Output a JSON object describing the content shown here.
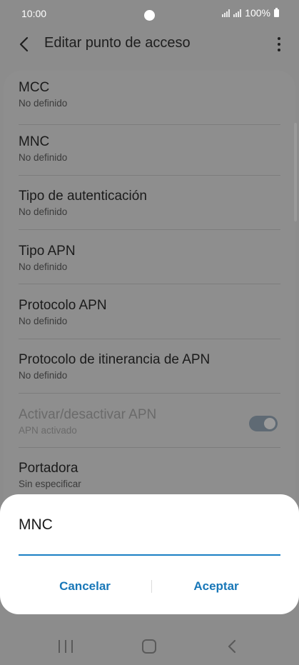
{
  "status_bar": {
    "time": "10:00",
    "battery": "100%"
  },
  "app_bar": {
    "title": "Editar punto de acceso"
  },
  "settings": [
    {
      "title": "MCC",
      "subtitle": "No definido"
    },
    {
      "title": "MNC",
      "subtitle": "No definido"
    },
    {
      "title": "Tipo de autenticación",
      "subtitle": "No definido"
    },
    {
      "title": "Tipo APN",
      "subtitle": "No definido"
    },
    {
      "title": "Protocolo APN",
      "subtitle": "No definido"
    },
    {
      "title": "Protocolo de itinerancia de APN",
      "subtitle": "No definido"
    },
    {
      "title": "Activar/desactivar APN",
      "subtitle": "APN activado"
    },
    {
      "title": "Portadora",
      "subtitle": "Sin especificar"
    }
  ],
  "toggle": {
    "enabled": true,
    "disabled_state": true
  },
  "dialog": {
    "title": "MNC",
    "input_value": "",
    "cancel_label": "Cancelar",
    "accept_label": "Aceptar"
  },
  "colors": {
    "accent": "#1877b8",
    "dim_background": "#8c8c8c"
  },
  "icons": {
    "back": "chevron-left-icon",
    "more": "more-vertical-icon",
    "nav_recents": "recents-icon",
    "nav_home": "home-icon",
    "nav_back": "back-icon"
  }
}
